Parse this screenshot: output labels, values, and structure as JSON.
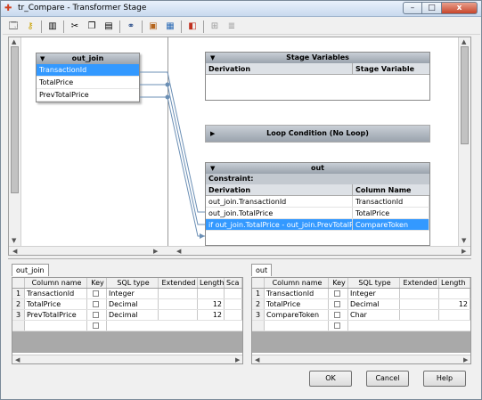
{
  "window": {
    "title": "tr_Compare - Transformer Stage",
    "close_glyph": "x"
  },
  "toolbar": {
    "icons": [
      "properties-icon",
      "key-icon",
      "columns-icon",
      "cut-icon",
      "copy-icon",
      "paste-icon",
      "find-icon",
      "load-icon",
      "save-icon",
      "stage-vars-icon",
      "constraints-icon",
      "autoarrange-icon"
    ]
  },
  "link_box": {
    "title": "out_join",
    "rows": [
      "TransactionId",
      "TotalPrice",
      "PrevTotalPrice"
    ]
  },
  "stage_variables": {
    "title": "Stage Variables",
    "col_derivation": "Derivation",
    "col_stagevar": "Stage Variable"
  },
  "loop_condition": {
    "title": "Loop Condition (No Loop)"
  },
  "out_panel": {
    "title": "out",
    "constraint_label": "Constraint:",
    "col_derivation": "Derivation",
    "col_name": "Column Name",
    "rows": [
      {
        "derivation": "out_join.TransactionId",
        "name": "TransactionId"
      },
      {
        "derivation": "out_join.TotalPrice",
        "name": "TotalPrice"
      },
      {
        "derivation": "if out_join.TotalPrice - out_join.PrevTotalPrice >",
        "name": "CompareToken"
      }
    ]
  },
  "left_grid": {
    "tab": "out_join",
    "headers": [
      "",
      "Column name",
      "Key",
      "SQL type",
      "Extended",
      "Length",
      "Sca"
    ],
    "rows": [
      {
        "n": "1",
        "name": "TransactionId",
        "type": "Integer",
        "ext": "",
        "len": ""
      },
      {
        "n": "2",
        "name": "TotalPrice",
        "type": "Decimal",
        "ext": "",
        "len": "12"
      },
      {
        "n": "3",
        "name": "PrevTotalPrice",
        "type": "Decimal",
        "ext": "",
        "len": "12"
      }
    ]
  },
  "right_grid": {
    "tab": "out",
    "headers": [
      "",
      "Column name",
      "Key",
      "SQL type",
      "Extended",
      "Length"
    ],
    "rows": [
      {
        "n": "1",
        "name": "TransactionId",
        "type": "Integer",
        "ext": "",
        "len": ""
      },
      {
        "n": "2",
        "name": "TotalPrice",
        "type": "Decimal",
        "ext": "",
        "len": "12"
      },
      {
        "n": "3",
        "name": "CompareToken",
        "type": "Char",
        "ext": "",
        "len": ""
      }
    ]
  },
  "buttons": {
    "ok": "OK",
    "cancel": "Cancel",
    "help": "Help"
  }
}
